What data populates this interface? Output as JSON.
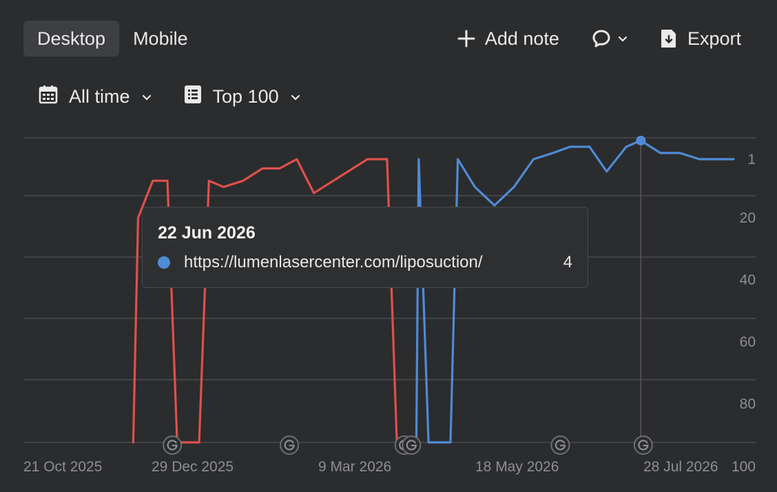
{
  "device_tabs": [
    {
      "label": "Desktop",
      "active": true
    },
    {
      "label": "Mobile",
      "active": false
    }
  ],
  "actions": {
    "add_note": "Add note",
    "comment_icon": "comment-bubble-icon",
    "export": "Export"
  },
  "filters": {
    "period": "All time",
    "top": "Top 100"
  },
  "colors": {
    "background": "#2b2c2e",
    "series_red": "#e0504a",
    "series_blue": "#4f8bd6",
    "grid": "#4a4b4f",
    "axis_text": "#8e8f93"
  },
  "tooltip": {
    "date": "22 Jun 2026",
    "url": "https://lumenlasercenter.com/liposuction/",
    "value": "4"
  },
  "chart_data": {
    "type": "line",
    "y_axis": {
      "reversed": true,
      "ticks": [
        "1",
        "20",
        "40",
        "60",
        "80",
        "100"
      ],
      "tick_values": [
        1,
        20,
        40,
        60,
        80,
        100
      ],
      "ylim": [
        1,
        100
      ],
      "position": "right"
    },
    "x_axis": {
      "ticks": [
        "21 Oct 2025",
        "29 Dec 2025",
        "9 Mar 2026",
        "18 May 2026",
        "28 Jul 2026"
      ],
      "tick_dates": [
        "2025-10-21",
        "2025-12-29",
        "2026-03-09",
        "2026-05-18",
        "2026-07-28"
      ],
      "xlim": [
        "2025-10-21",
        "2026-07-28"
      ]
    },
    "grid": true,
    "series": [
      {
        "color": "#e0504a",
        "points": [
          [
            "2025-12-05",
            100
          ],
          [
            "2025-12-07",
            20
          ],
          [
            "2025-12-13",
            8
          ],
          [
            "2025-12-19",
            8
          ],
          [
            "2025-12-23",
            100
          ],
          [
            "2026-01-01",
            100
          ],
          [
            "2026-01-05",
            8
          ],
          [
            "2026-01-11",
            10
          ],
          [
            "2026-01-19",
            8
          ],
          [
            "2026-01-27",
            4
          ],
          [
            "2026-02-03",
            4
          ],
          [
            "2026-02-10",
            1
          ],
          [
            "2026-02-17",
            12
          ],
          [
            "2026-02-25",
            8
          ],
          [
            "2026-03-03",
            5
          ],
          [
            "2026-03-11",
            1
          ],
          [
            "2026-03-19",
            1
          ],
          [
            "2026-03-23",
            100
          ]
        ]
      },
      {
        "name": "https://lumenlasercenter.com/liposuction/",
        "color": "#4f8bd6",
        "points": [
          [
            "2026-03-31",
            100
          ],
          [
            "2026-04-01",
            1
          ],
          [
            "2026-04-05",
            100
          ],
          [
            "2026-04-14",
            100
          ],
          [
            "2026-04-17",
            1
          ],
          [
            "2026-04-24",
            10
          ],
          [
            "2026-05-02",
            16
          ],
          [
            "2026-05-10",
            10
          ],
          [
            "2026-05-18",
            1
          ],
          [
            "2026-05-26",
            0
          ],
          [
            "2026-06-02",
            -1
          ],
          [
            "2026-06-10",
            -1
          ],
          [
            "2026-06-17",
            5
          ],
          [
            "2026-06-25",
            -1
          ],
          [
            "2026-07-01",
            -2
          ],
          [
            "2026-07-09",
            0
          ],
          [
            "2026-07-17",
            0
          ],
          [
            "2026-07-25",
            1
          ],
          [
            "2026-08-02",
            1
          ],
          [
            "2026-08-08",
            1
          ]
        ],
        "highlight": [
          "2026-07-01",
          -2
        ]
      }
    ],
    "google_update_markers": [
      "2025-12-21",
      "2026-02-07",
      "2026-03-26",
      "2026-03-29",
      "2026-05-29",
      "2026-07-02"
    ]
  }
}
